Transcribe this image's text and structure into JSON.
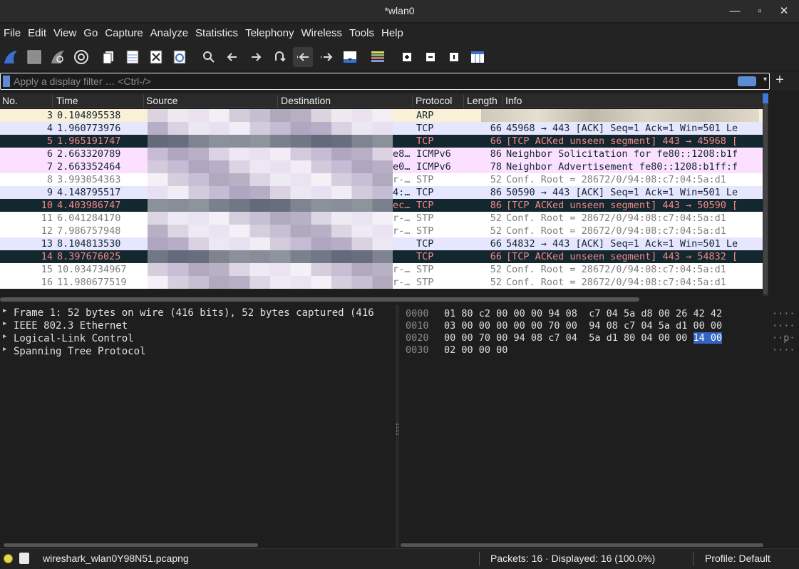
{
  "window": {
    "title": "*wlan0",
    "minimize": "—",
    "maximize": "▫",
    "close": "✕"
  },
  "menu": [
    "File",
    "Edit",
    "View",
    "Go",
    "Capture",
    "Analyze",
    "Statistics",
    "Telephony",
    "Wireless",
    "Tools",
    "Help"
  ],
  "toolbar_icons": [
    "shark-fin-start-icon",
    "stop-capture-icon",
    "restart-capture-icon",
    "capture-options-icon",
    "open-file-icon",
    "save-file-icon",
    "close-file-icon",
    "reload-file-icon",
    "find-packet-icon",
    "go-back-icon",
    "go-forward-icon",
    "go-to-packet-icon",
    "go-first-icon",
    "go-last-icon",
    "autoscroll-icon",
    "colorize-icon",
    "zoom-in-icon",
    "zoom-out-icon",
    "normal-size-icon",
    "resize-columns-icon"
  ],
  "filter": {
    "placeholder": "Apply a display filter … <Ctrl-/>",
    "plus": "+"
  },
  "packet_list": {
    "columns": [
      "No.",
      "Time",
      "Source",
      "Destination",
      "Protocol",
      "Length",
      "Info"
    ],
    "rows": [
      {
        "no": "3",
        "time": "0.104895538",
        "dtail": "",
        "proto": "ARP",
        "len": "",
        "info": "",
        "style": "arp"
      },
      {
        "no": "4",
        "time": "1.960773976",
        "dtail": "",
        "proto": "TCP",
        "len": "66",
        "info": "45968 → 443 [ACK] Seq=1 Ack=1 Win=501 Le",
        "style": "tcp"
      },
      {
        "no": "5",
        "time": "1.965191747",
        "dtail": "",
        "proto": "TCP",
        "len": "66",
        "info": "[TCP ACKed unseen segment] 443 → 45968 [",
        "style": "bad"
      },
      {
        "no": "6",
        "time": "2.663320789",
        "dtail": "e8…",
        "proto": "ICMPv6",
        "len": "86",
        "info": "Neighbor Solicitation for fe80::1208:b1f",
        "style": "icmp"
      },
      {
        "no": "7",
        "time": "2.663352464",
        "dtail": "e0…",
        "proto": "ICMPv6",
        "len": "78",
        "info": "Neighbor Advertisement fe80::1208:b1ff:f",
        "style": "icmp"
      },
      {
        "no": "8",
        "time": "3.993054363",
        "dtail": "r-…",
        "proto": "STP",
        "len": "52",
        "info": "Conf. Root = 28672/0/94:08:c7:04:5a:d1",
        "style": "stp"
      },
      {
        "no": "9",
        "time": "4.148795517",
        "dtail": "4:…",
        "proto": "TCP",
        "len": "86",
        "info": "50590 → 443 [ACK] Seq=1 Ack=1 Win=501 Le",
        "style": "tcp"
      },
      {
        "no": "10",
        "time": "4.403986747",
        "dtail": "ec…",
        "proto": "TCP",
        "len": "86",
        "info": "[TCP ACKed unseen segment] 443 → 50590 [",
        "style": "bad"
      },
      {
        "no": "11",
        "time": "6.041284170",
        "dtail": "r-…",
        "proto": "STP",
        "len": "52",
        "info": "Conf. Root = 28672/0/94:08:c7:04:5a:d1",
        "style": "stp"
      },
      {
        "no": "12",
        "time": "7.986757948",
        "dtail": "r-…",
        "proto": "STP",
        "len": "52",
        "info": "Conf. Root = 28672/0/94:08:c7:04:5a:d1",
        "style": "stp"
      },
      {
        "no": "13",
        "time": "8.104813530",
        "dtail": "",
        "proto": "TCP",
        "len": "66",
        "info": "54832 → 443 [ACK] Seq=1 Ack=1 Win=501 Le",
        "style": "tcp"
      },
      {
        "no": "14",
        "time": "8.397676025",
        "dtail": "",
        "proto": "TCP",
        "len": "66",
        "info": "[TCP ACKed unseen segment] 443 → 54832 [",
        "style": "bad"
      },
      {
        "no": "15",
        "time": "10.034734967",
        "dtail": "r-…",
        "proto": "STP",
        "len": "52",
        "info": "Conf. Root = 28672/0/94:08:c7:04:5a:d1",
        "style": "stp"
      },
      {
        "no": "16",
        "time": "11.980677519",
        "dtail": "r-…",
        "proto": "STP",
        "len": "52",
        "info": "Conf. Root = 28672/0/94:08:c7:04:5a:d1",
        "style": "stp"
      }
    ]
  },
  "details": [
    "Frame 1: 52 bytes on wire (416 bits), 52 bytes captured (416",
    "IEEE 802.3 Ethernet",
    "Logical-Link Control",
    "Spanning Tree Protocol"
  ],
  "hex": [
    {
      "off": "0000",
      "bytes": "01 80 c2 00 00 00 94 08  c7 04 5a d8 00 26 42 42",
      "sel": "",
      "ascii": "····"
    },
    {
      "off": "0010",
      "bytes": "03 00 00 00 00 00 70 00  94 08 c7 04 5a d1 00 00",
      "sel": "",
      "ascii": "····"
    },
    {
      "off": "0020",
      "bytes": "00 00 70 00 94 08 c7 04  5a d1 80 04 00 00 ",
      "sel": "14 00",
      "ascii": "··p·"
    },
    {
      "off": "0030",
      "bytes": "02 00 00 00",
      "sel": "",
      "ascii": "····"
    }
  ],
  "status": {
    "file": "wireshark_wlan0Y98N51.pcapng",
    "packets": "Packets: 16 · Displayed: 16 (100.0%)",
    "profile": "Profile: Default"
  },
  "colors": {
    "arp": {
      "bg": "#faf0d7",
      "fg": "#12272e"
    },
    "tcp": {
      "bg": "#e7e6ff",
      "fg": "#12272e"
    },
    "bad": {
      "bg": "#12272e",
      "fg": "#f78787"
    },
    "icmp": {
      "bg": "#fce0ff",
      "fg": "#12272e"
    },
    "stp": {
      "bg": "#ffffff",
      "fg": "#7f7f7f"
    },
    "selection": "#3465c4",
    "accent": "#5d8bd4"
  }
}
